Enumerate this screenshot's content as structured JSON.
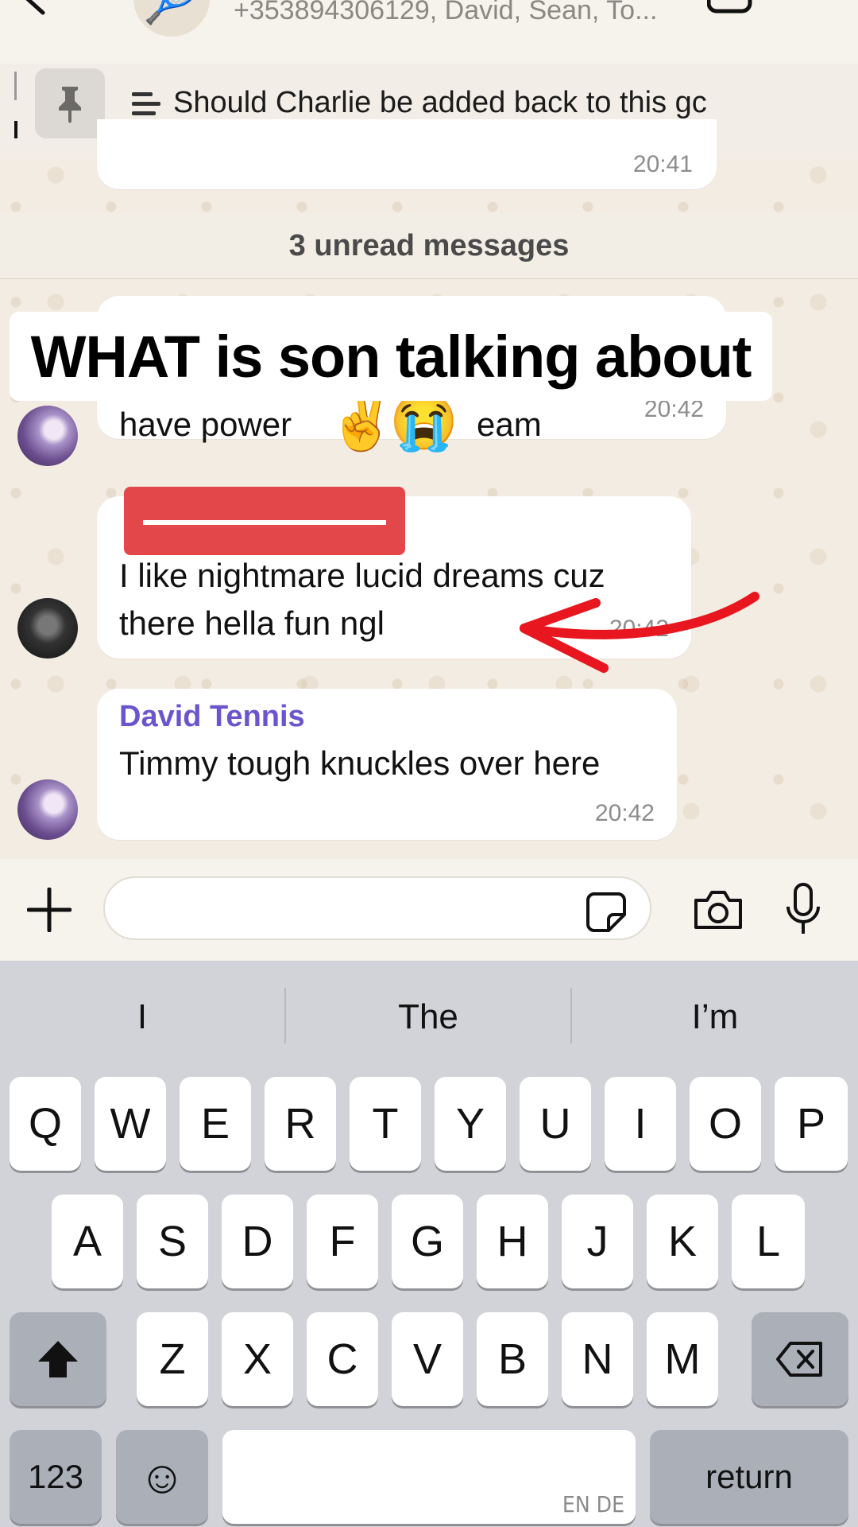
{
  "header": {
    "participants": "+353894306129, David, Sean, To...",
    "group_avatar_emoji": "🎾"
  },
  "pinned": {
    "text": "Should Charlie be added back to this gc"
  },
  "messages": {
    "clipped_time": "20:41",
    "unread_banner": "3 unread messages",
    "caption": "WHAT is son talking about",
    "m1": {
      "text_left": "have power",
      "text_right": "eam",
      "emoji_1": "✌️",
      "emoji_2": "😭",
      "time": "20:42"
    },
    "m2": {
      "line1": "I like nightmare lucid dreams cuz",
      "line2": "there hella fun ngl",
      "time": "20:42"
    },
    "m3": {
      "sender": "David Tennis",
      "text": "Timmy tough knuckles over here",
      "time": "20:42"
    }
  },
  "keyboard": {
    "suggestions": [
      "I",
      "The",
      "I’m"
    ],
    "row1": [
      "Q",
      "W",
      "E",
      "R",
      "T",
      "Y",
      "U",
      "I",
      "O",
      "P"
    ],
    "row2": [
      "A",
      "S",
      "D",
      "F",
      "G",
      "H",
      "J",
      "K",
      "L"
    ],
    "row3": [
      "Z",
      "X",
      "C",
      "V",
      "B",
      "N",
      "M"
    ],
    "numbers_label": "123",
    "return_label": "return",
    "space_hint": "EN DE",
    "emoji_key": "☺"
  },
  "colors": {
    "sender_name": "#6a55cf",
    "redaction": "#e3474a",
    "annotation_arrow": "#e8161e"
  }
}
